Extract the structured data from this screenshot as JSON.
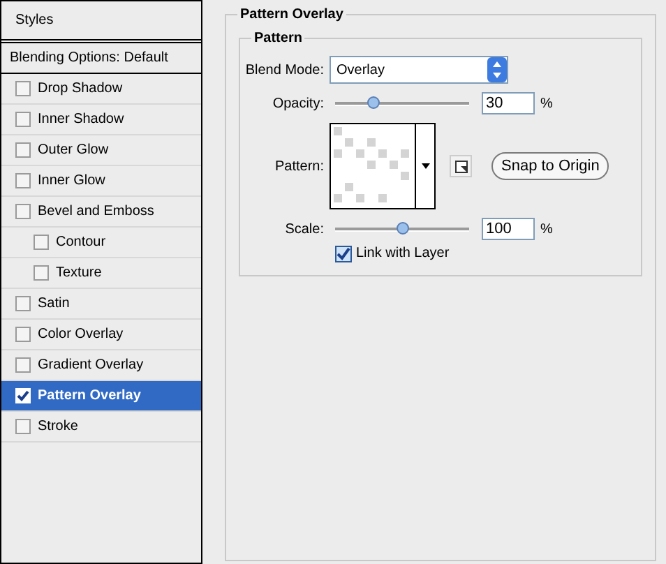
{
  "sidebar": {
    "header": "Styles",
    "blending": "Blending Options: Default",
    "items": [
      {
        "label": "Drop Shadow",
        "checked": false,
        "selected": false
      },
      {
        "label": "Inner Shadow",
        "checked": false,
        "selected": false
      },
      {
        "label": "Outer Glow",
        "checked": false,
        "selected": false
      },
      {
        "label": "Inner Glow",
        "checked": false,
        "selected": false
      },
      {
        "label": "Bevel and Emboss",
        "checked": false,
        "selected": false,
        "children": [
          {
            "label": "Contour",
            "checked": false,
            "selected": false
          },
          {
            "label": "Texture",
            "checked": false,
            "selected": false
          }
        ]
      },
      {
        "label": "Satin",
        "checked": false,
        "selected": false
      },
      {
        "label": "Color Overlay",
        "checked": false,
        "selected": false
      },
      {
        "label": "Gradient Overlay",
        "checked": false,
        "selected": false
      },
      {
        "label": "Pattern Overlay",
        "checked": true,
        "selected": true
      },
      {
        "label": "Stroke",
        "checked": false,
        "selected": false
      }
    ]
  },
  "panel": {
    "title": "Pattern Overlay",
    "group": "Pattern",
    "blend_mode": {
      "label": "Blend Mode:",
      "value": "Overlay"
    },
    "opacity": {
      "label": "Opacity:",
      "level": 0.28,
      "value": "30",
      "unit": "%"
    },
    "pattern": {
      "label": "Pattern:",
      "button": "Snap to Origin"
    },
    "scale": {
      "label": "Scale:",
      "level": 0.5,
      "value": "100",
      "unit": "%"
    },
    "link": {
      "label": "Link with Layer",
      "checked": true
    }
  }
}
